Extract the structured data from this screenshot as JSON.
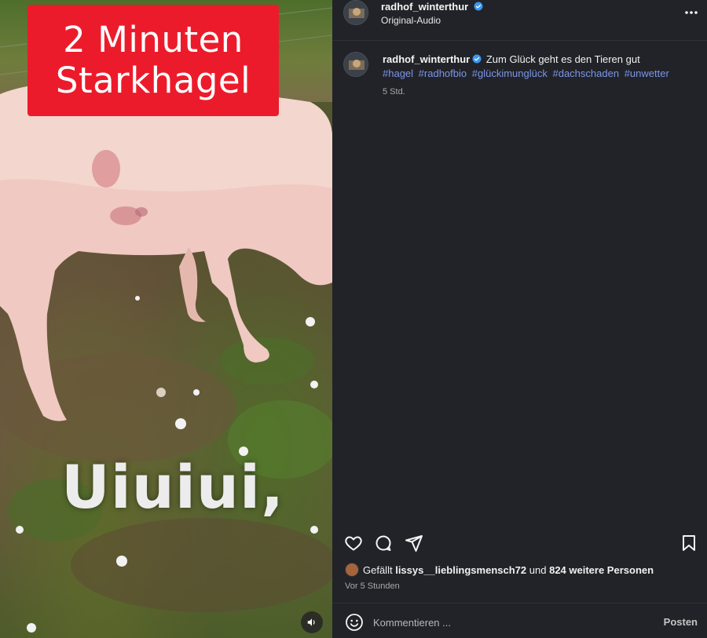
{
  "media": {
    "banner_line1": "2 Minuten",
    "banner_line2": "Starkhagel",
    "overlay_caption": "Uiuiui,",
    "volume_icon": "speaker-icon"
  },
  "header": {
    "username": "radhof_winterthur",
    "audio_label": "Original-Audio",
    "more_icon": "more-dots-icon"
  },
  "caption": {
    "username": "radhof_winterthur",
    "text": "Zum Glück geht es den Tieren gut",
    "hashtags": [
      "#hagel",
      "#radhofbio",
      "#glückimunglück",
      "#dachschaden",
      "#unwetter"
    ],
    "timestamp_short": "5 Std."
  },
  "actions": {
    "like_icon": "heart-icon",
    "comment_icon": "comment-icon",
    "share_icon": "share-icon",
    "save_icon": "bookmark-icon"
  },
  "likes": {
    "prefix": "Gefällt",
    "liker": "lissys__lieblingsmensch72",
    "conjunction": "und",
    "others": "824 weitere Personen"
  },
  "time_ago": "Vor 5 Stunden",
  "comment": {
    "placeholder": "Kommentieren ...",
    "post_label": "Posten",
    "emoji_icon": "emoji-icon"
  },
  "colors": {
    "banner_red": "#ec1b2b",
    "panel_bg": "#212328",
    "hashtag_blue": "#7d95e8",
    "verified_blue": "#3897f0"
  }
}
